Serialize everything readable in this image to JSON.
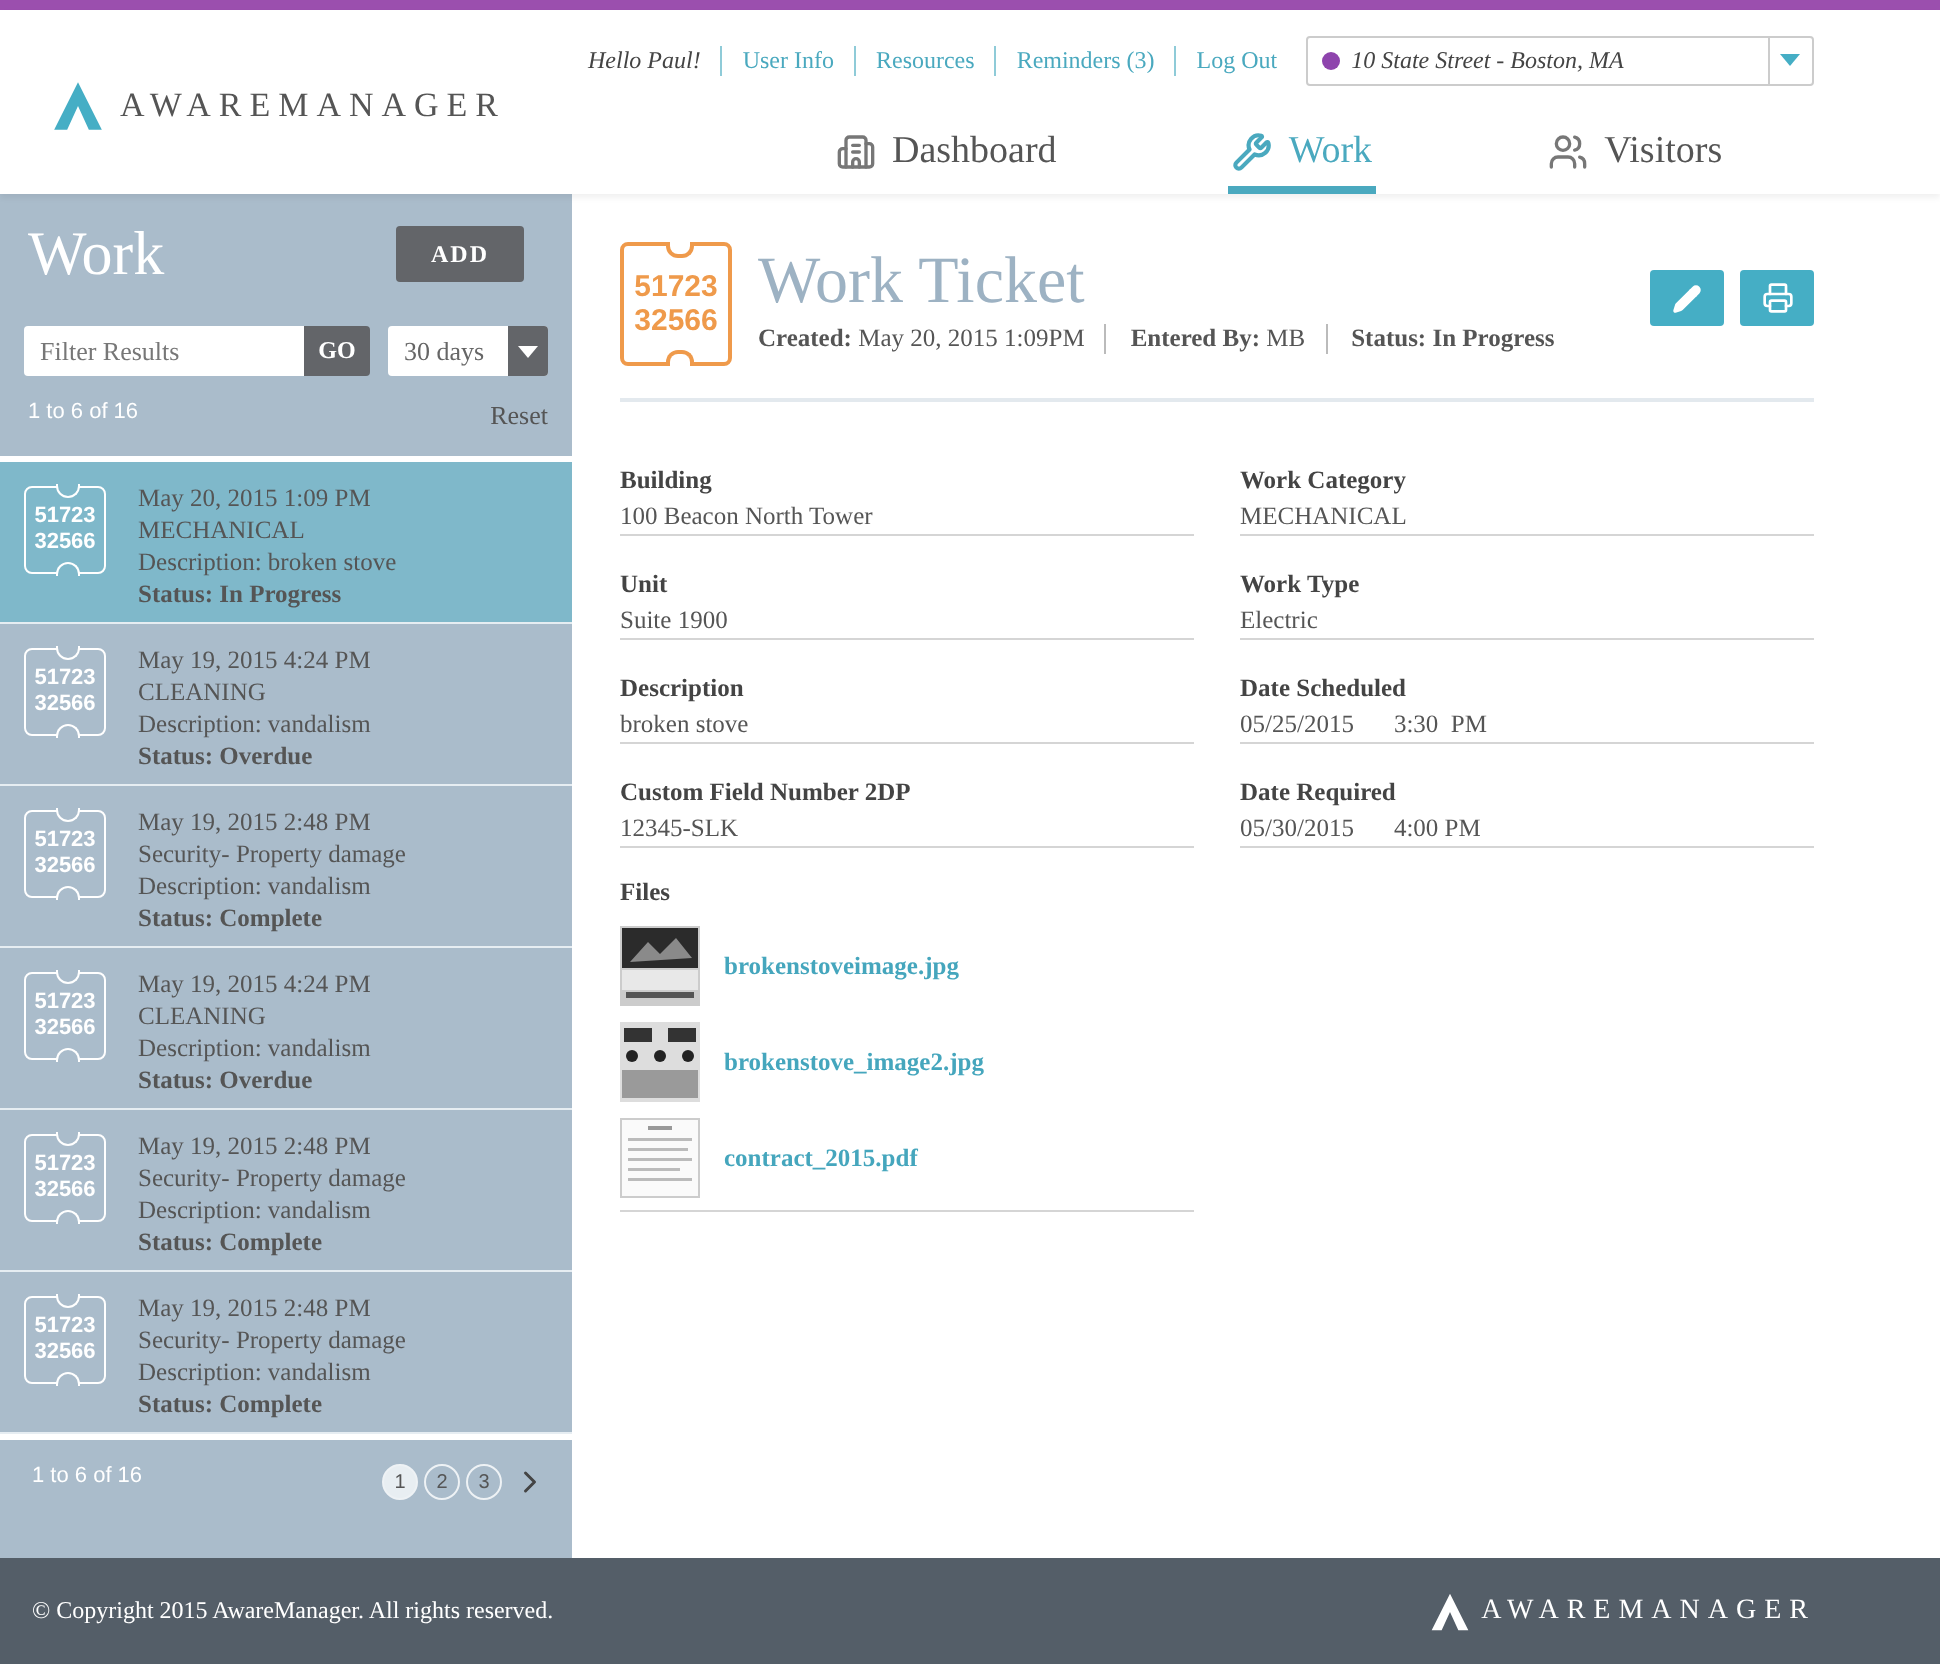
{
  "header": {
    "logo": "AWAREMANAGER",
    "greeting": "Hello Paul!",
    "links": [
      "User Info",
      "Resources",
      "Reminders (3)",
      "Log Out"
    ],
    "location": {
      "text": "10 State Street - Boston, MA",
      "color": "#8e44ad"
    },
    "nav": [
      {
        "label": "Dashboard",
        "kind": "building",
        "selected": false
      },
      {
        "label": "Work",
        "kind": "tools",
        "selected": true
      },
      {
        "label": "Visitors",
        "kind": "users",
        "selected": false
      }
    ]
  },
  "sidebar": {
    "title": "Work",
    "add_button": "ADD",
    "filter": {
      "placeholder": "Filter Results",
      "button": "GO"
    },
    "range": "30 days",
    "count": "1 to 6 of 16",
    "reset": "Reset",
    "items": [
      {
        "ticket": [
          "51723",
          "32566"
        ],
        "date": "May 20, 2015 1:09 PM",
        "category": "MECHANICAL",
        "description": "Description: broken stove",
        "status": "Status: In Progress",
        "selected": true
      },
      {
        "ticket": [
          "51723",
          "32566"
        ],
        "date": "May 19, 2015 4:24 PM",
        "category": "CLEANING",
        "description": "Description: vandalism",
        "status": "Status: Overdue",
        "selected": false
      },
      {
        "ticket": [
          "51723",
          "32566"
        ],
        "date": "May 19, 2015 2:48 PM",
        "category": "Security- Property damage",
        "description": "Description: vandalism",
        "status": "Status: Complete",
        "selected": false
      },
      {
        "ticket": [
          "51723",
          "32566"
        ],
        "date": "May 19, 2015 4:24 PM",
        "category": "CLEANING",
        "description": "Description: vandalism",
        "status": "Status: Overdue",
        "selected": false
      },
      {
        "ticket": [
          "51723",
          "32566"
        ],
        "date": "May 19, 2015 2:48 PM",
        "category": "Security- Property damage",
        "description": "Description: vandalism",
        "status": "Status: Complete",
        "selected": false
      },
      {
        "ticket": [
          "51723",
          "32566"
        ],
        "date": "May 19, 2015 2:48 PM",
        "category": "Security- Property damage",
        "description": "Description: vandalism",
        "status": "Status: Complete",
        "selected": false
      }
    ],
    "pagination": {
      "count": "1 to 6 of 16",
      "pages": [
        {
          "label": "1",
          "selected": true
        },
        {
          "label": "2",
          "selected": false
        },
        {
          "label": "3",
          "selected": false
        }
      ]
    }
  },
  "ticket": {
    "number": [
      "51723",
      "32566"
    ],
    "title": "Work Ticket",
    "meta": [
      {
        "label": "Created:",
        "value": "May 20, 2015 1:09PM",
        "strong": false
      },
      {
        "label": "Entered By:",
        "value": "MB",
        "strong": false
      },
      {
        "label": "Status:",
        "value": "In Progress",
        "strong": true
      }
    ],
    "left_fields": [
      {
        "label": "Building",
        "value": "100 Beacon North Tower"
      },
      {
        "label": "Unit",
        "value": "Suite 1900"
      },
      {
        "label": "Description",
        "value": "broken stove"
      },
      {
        "label": "Custom Field Number 2DP",
        "value": "12345-SLK"
      }
    ],
    "right_fields": [
      {
        "label": "Work Category",
        "value": "MECHANICAL"
      },
      {
        "label": "Work Type",
        "value": "Electric"
      },
      {
        "label": "Date Scheduled",
        "value": "05/25/2015",
        "time": "3:30  PM"
      },
      {
        "label": "Date Required",
        "value": "05/30/2015",
        "time": "4:00 PM"
      }
    ],
    "files": {
      "label": "Files",
      "items": [
        {
          "name": "brokenstoveimage.jpg"
        },
        {
          "name": "brokenstove_image2.jpg",
          "kind": "burners"
        },
        {
          "name": "contract_2015.pdf",
          "kind": "document"
        }
      ]
    }
  },
  "footer": {
    "copyright": "© Copyright 2015 AwareManager. All rights reserved.",
    "logo": "AWAREMANAGER"
  }
}
